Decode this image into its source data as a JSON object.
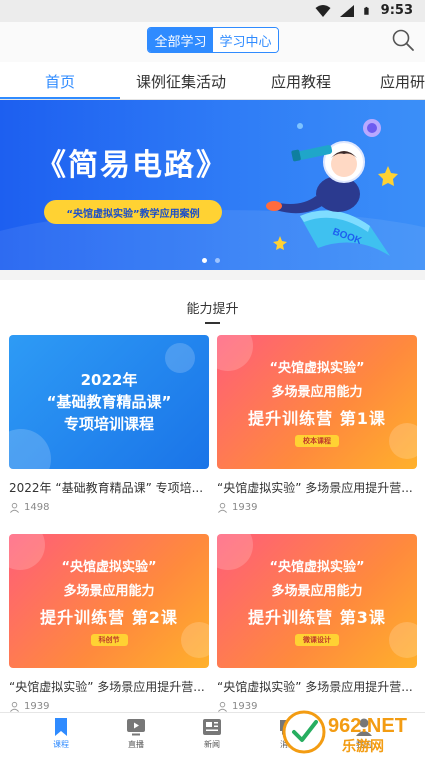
{
  "status_bar": {
    "time": "9:53"
  },
  "header": {
    "segments": [
      "全部学习",
      "学习中心"
    ],
    "active_segment": 0
  },
  "tabs": [
    "首页",
    "课例征集活动",
    "应用教程",
    "应用研"
  ],
  "banner": {
    "title": "《简易电路》",
    "subtitle": "“央馆虚拟实验”教学应用案例",
    "book_label": "BOOK",
    "page_count": 2,
    "active_page": 0
  },
  "section": {
    "title": "能力提升"
  },
  "courses": [
    {
      "thumb_lines": [
        "2022年",
        "“基础教育精品课”",
        "专项培训课程"
      ],
      "badge": "",
      "title": "2022年 “基础教育精品课” 专项培...",
      "learners": "1498"
    },
    {
      "thumb_lines": [
        "“央馆虚拟实验”",
        "多场景应用能力",
        "提升训练营 第1课"
      ],
      "badge": "校本课程",
      "title": "“央馆虚拟实验” 多场景应用提升营...",
      "learners": "1939"
    },
    {
      "thumb_lines": [
        "“央馆虚拟实验”",
        "多场景应用能力",
        "提升训练营 第2课"
      ],
      "badge": "科创节",
      "title": "“央馆虚拟实验” 多场景应用提升营...",
      "learners": "1939"
    },
    {
      "thumb_lines": [
        "“央馆虚拟实验”",
        "多场景应用能力",
        "提升训练营 第3课"
      ],
      "badge": "微课设计",
      "title": "“央馆虚拟实验” 多场景应用提升营...",
      "learners": "1939"
    }
  ],
  "bottom_nav": [
    {
      "label": "课程",
      "icon": "bookmark-icon"
    },
    {
      "label": "直播",
      "icon": "video-icon"
    },
    {
      "label": "新闻",
      "icon": "newspaper-icon"
    },
    {
      "label": "消息",
      "icon": "message-icon"
    },
    {
      "label": "我的",
      "icon": "user-icon"
    }
  ],
  "watermark": {
    "brand": "962.NET",
    "sub": "乐游网"
  },
  "colors": {
    "accent": "#2f8bff",
    "banner_blue": "#1d5ff0",
    "badge_yellow": "#ffd233"
  }
}
